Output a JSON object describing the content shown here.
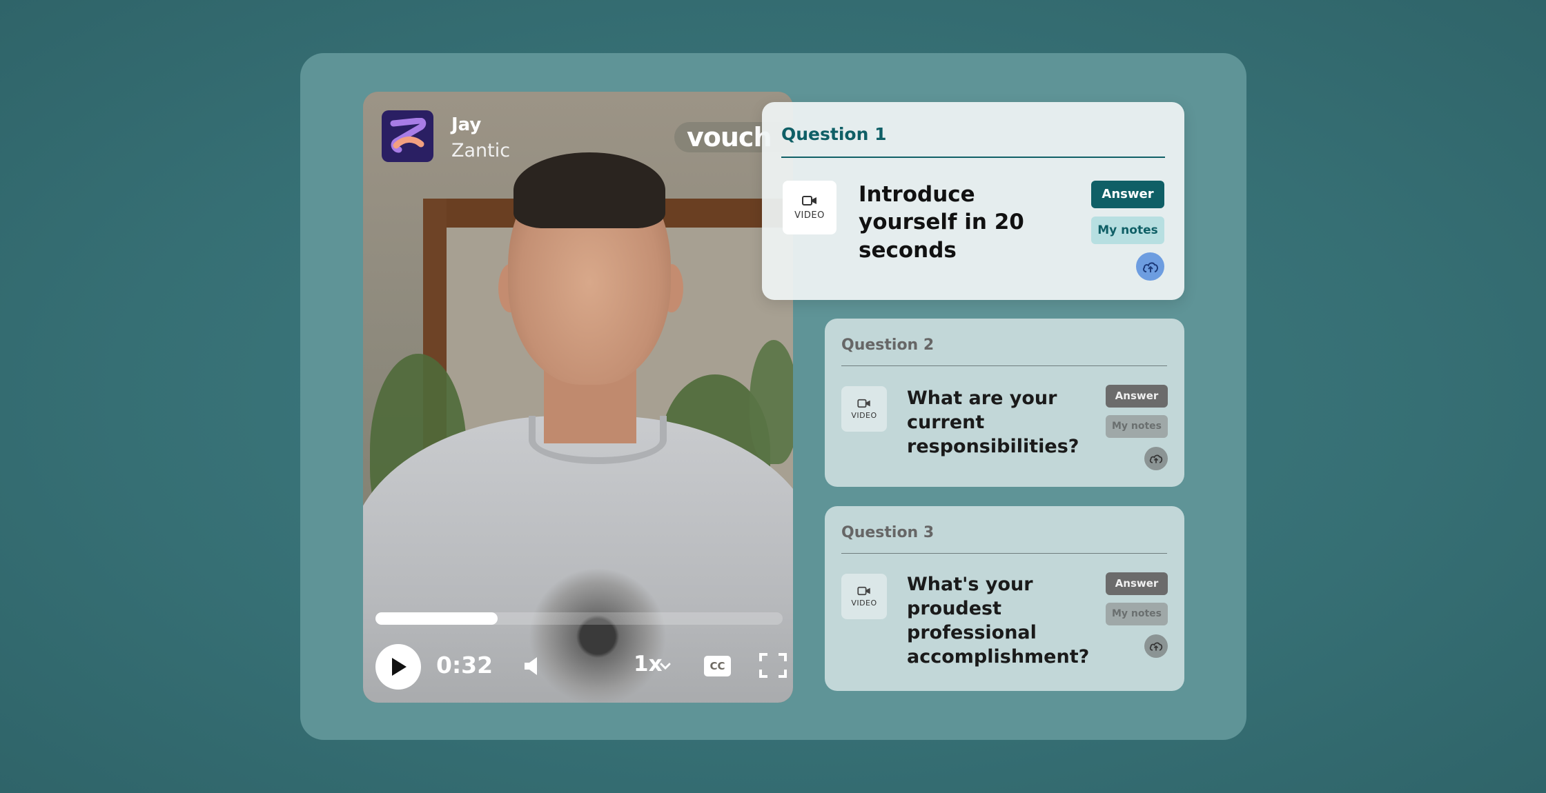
{
  "player": {
    "person_name": "Jay",
    "company": "Zantic",
    "brand_badge": "vouch",
    "time": "0:32",
    "speed": "1x",
    "captions_label": "CC",
    "progress": 0.3
  },
  "questions": [
    {
      "title": "Question 1",
      "media_type": "VIDEO",
      "text": "Introduce yourself in 20 seconds",
      "answer_label": "Answer",
      "notes_label": "My notes",
      "active": true
    },
    {
      "title": "Question 2",
      "media_type": "VIDEO",
      "text": "What are your current responsibilities?",
      "answer_label": "Answer",
      "notes_label": "My notes",
      "active": false
    },
    {
      "title": "Question 3",
      "media_type": "VIDEO",
      "text": "What's your proudest professional accomplishment?",
      "answer_label": "Answer",
      "notes_label": "My notes",
      "active": false
    }
  ],
  "colors": {
    "accent": "#0f5f66",
    "accent_light": "#b7dfe1",
    "upload_active": "#6d9de0",
    "muted_button": "#6b6b6b"
  },
  "icons": {
    "video": "video-camera-icon",
    "upload": "cloud-upload-icon",
    "play": "play-icon",
    "volume": "volume-icon",
    "fullscreen": "fullscreen-icon"
  }
}
